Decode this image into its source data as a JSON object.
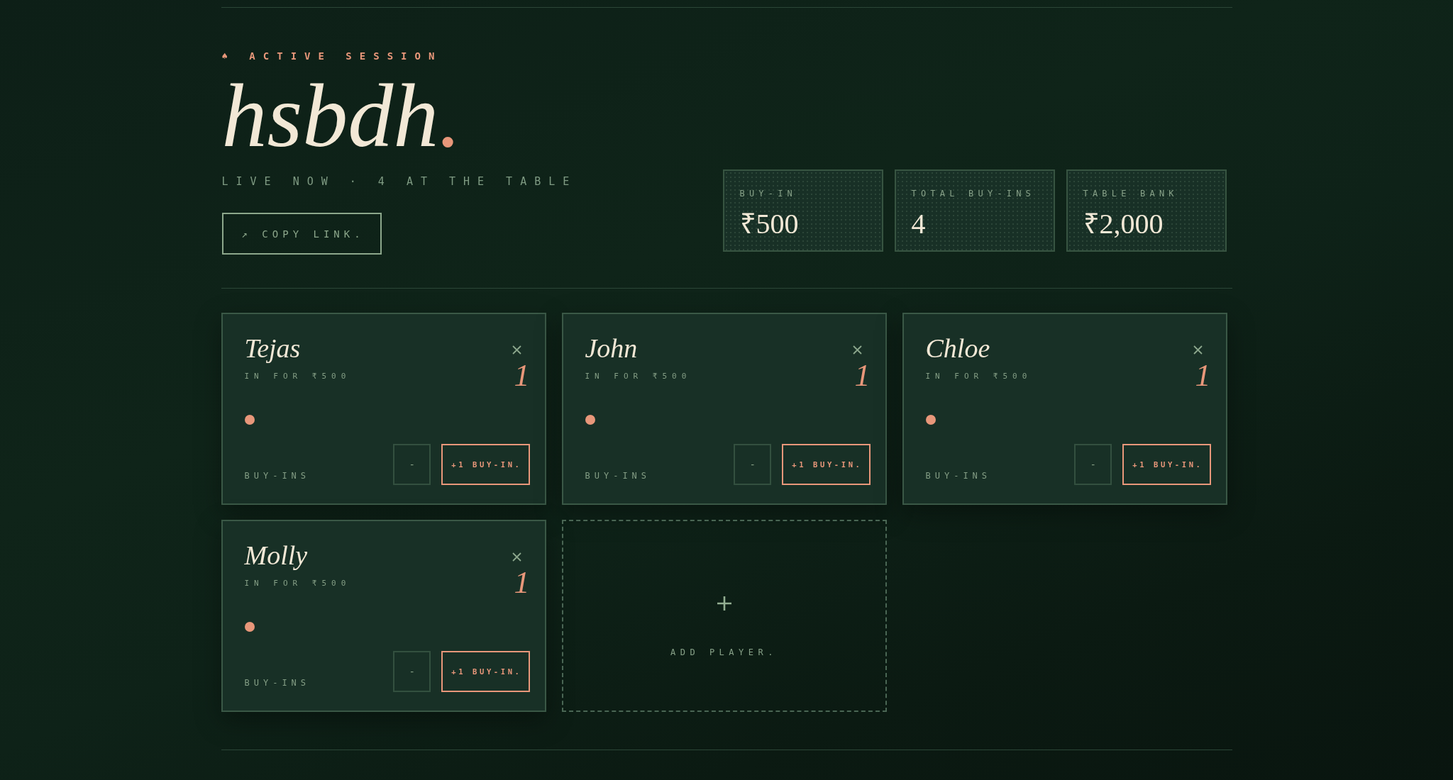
{
  "header": {
    "eyebrow": "♠ ACTIVE SESSION",
    "title": "hsbdh",
    "title_accent": ".",
    "status": "LIVE NOW · 4 AT THE TABLE",
    "copy_link_button": "↗ COPY LINK."
  },
  "stats": [
    {
      "label": "BUY-IN",
      "value": "₹500"
    },
    {
      "label": "TOTAL BUY-INS",
      "value": "4"
    },
    {
      "label": "TABLE BANK",
      "value": "₹2,000"
    }
  ],
  "players": [
    {
      "name": "Tejas",
      "stake": "IN FOR ₹500",
      "buy_ins": "1",
      "buy_ins_label": "BUY-INS",
      "decrement_button": "-",
      "increment_button": "+1 BUY-IN."
    },
    {
      "name": "John",
      "stake": "IN FOR ₹500",
      "buy_ins": "1",
      "buy_ins_label": "BUY-INS",
      "decrement_button": "-",
      "increment_button": "+1 BUY-IN."
    },
    {
      "name": "Chloe",
      "stake": "IN FOR ₹500",
      "buy_ins": "1",
      "buy_ins_label": "BUY-INS",
      "decrement_button": "-",
      "increment_button": "+1 BUY-IN."
    },
    {
      "name": "Molly",
      "stake": "IN FOR ₹500",
      "buy_ins": "1",
      "buy_ins_label": "BUY-INS",
      "decrement_button": "-",
      "increment_button": "+1 BUY-IN."
    }
  ],
  "add_player": {
    "label": "ADD PLAYER."
  }
}
